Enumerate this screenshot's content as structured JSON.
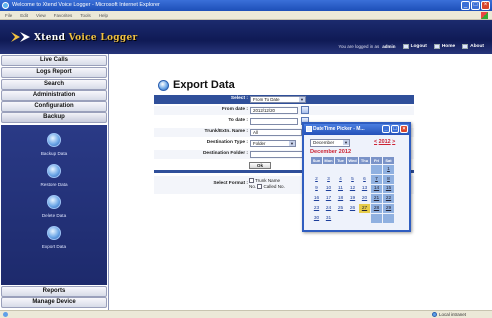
{
  "window": {
    "title": "Welcome to Xtend Voice Logger - Microsoft Internet Explorer",
    "menus": [
      "File",
      "Edit",
      "View",
      "Favorites",
      "Tools",
      "Help"
    ]
  },
  "header": {
    "logo_primary": "Xtend",
    "logo_secondary": "Voice Logger",
    "logged_in_prefix": "You are logged in as",
    "user": "admin",
    "links": {
      "logout": "Logout",
      "home": "Home",
      "about": "About"
    }
  },
  "sidebar": {
    "top_items": [
      "Live Calls",
      "Logs Report",
      "Search",
      "Administration",
      "Configuration",
      "Backup"
    ],
    "backup_items": [
      "Backup Data",
      "Restore Data",
      "Delete Data",
      "Export Data"
    ],
    "bottom_items": [
      "Reports",
      "Manage Device"
    ]
  },
  "main": {
    "title": "Export Data",
    "form": {
      "select_label": "Select :",
      "select_value": "From To Date",
      "from_date_label": "From date :",
      "from_date_value": "2012/12/20",
      "to_date_label": "To date :",
      "to_date_value": "",
      "trunk_label": "Trunk/Extn. Name :",
      "trunk_value": "All",
      "dest_type_label": "Destination Type :",
      "dest_type_value": "Folder",
      "dest_folder_label": "Destination Folder :",
      "dest_folder_value": "",
      "ok_label": "Ok",
      "format_label": "Select Format :",
      "format_option_1": "Trunk Name",
      "format_option_2": "Called No.",
      "format_prefix_2": "No."
    }
  },
  "datepicker": {
    "title": "DateTime Picker - M...",
    "month_select": "December",
    "year_prev": "<",
    "year": "2012",
    "year_next": ">",
    "month_caption": "December 2012",
    "weekdays": [
      "Sun",
      "Mon",
      "Tue",
      "Wed",
      "Thu",
      "Fri",
      "Sat"
    ],
    "weeks": [
      [
        "",
        "",
        "",
        "",
        "",
        "",
        "1"
      ],
      [
        "2",
        "3",
        "4",
        "5",
        "6",
        "7",
        "8"
      ],
      [
        "9",
        "10",
        "11",
        "12",
        "13",
        "14",
        "15"
      ],
      [
        "16",
        "17",
        "18",
        "19",
        "20",
        "21",
        "22"
      ],
      [
        "23",
        "24",
        "25",
        "26",
        "27",
        "28",
        "29"
      ],
      [
        "30",
        "31",
        "",
        "",
        "",
        "",
        ""
      ]
    ],
    "today": "27"
  },
  "statusbar": {
    "zone": "Local intranet"
  },
  "colors": {
    "header_bg": "#1c2b6e",
    "form_blue": "#2f4f9a",
    "today": "#e6cc4a",
    "weekend": "#8fb0e0"
  }
}
